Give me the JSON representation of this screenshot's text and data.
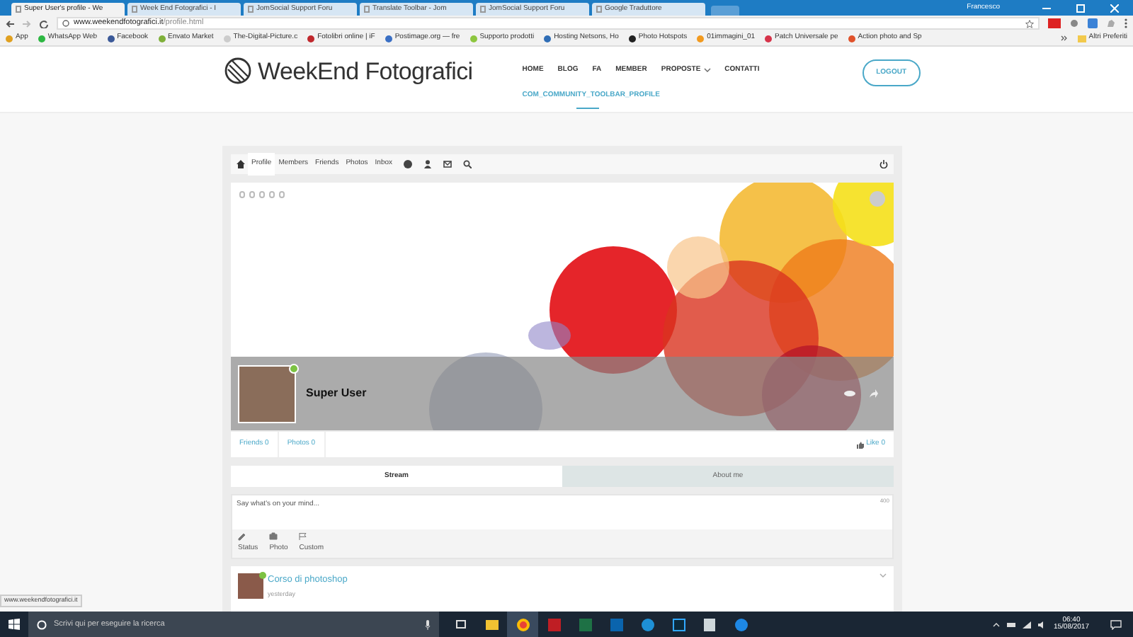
{
  "browser": {
    "tabs": [
      {
        "title": "Super User's profile - We",
        "selected": true
      },
      {
        "title": "Week End Fotografici - I",
        "selected": false
      },
      {
        "title": "JomSocial Support Foru",
        "selected": false
      },
      {
        "title": "Translate Toolbar - Jom",
        "selected": false
      },
      {
        "title": "JomSocial Support Foru",
        "selected": false
      },
      {
        "title": "Google Traduttore",
        "selected": false
      }
    ],
    "user": "Francesco",
    "url_host": "www.weekendfotografici.it",
    "url_path": "/profile.html",
    "bookmarks": [
      {
        "label": "App",
        "color": "#e0a020"
      },
      {
        "label": "WhatsApp Web",
        "color": "#2db742"
      },
      {
        "label": "Facebook",
        "color": "#3b5998"
      },
      {
        "label": "Envato Market",
        "color": "#7fb03a"
      },
      {
        "label": "The-Digital-Picture.c",
        "color": "#cccccc"
      },
      {
        "label": "Fotolibri online | iF",
        "color": "#c0282d"
      },
      {
        "label": "Postimage.org — fre",
        "color": "#3a6fc4"
      },
      {
        "label": "Supporto prodotti",
        "color": "#8dc63f"
      },
      {
        "label": "Hosting Netsons, Ho",
        "color": "#2f6db5"
      },
      {
        "label": "Photo Hotspots",
        "color": "#222222"
      },
      {
        "label": "01immagini_01",
        "color": "#f29a1f"
      },
      {
        "label": "Patch Universale pe",
        "color": "#d6334a"
      },
      {
        "label": "Action photo and Sp",
        "color": "#e0522b"
      }
    ],
    "other_bookmarks": "Altri Preferiti"
  },
  "site": {
    "logo": "WeekEnd Fotografici",
    "nav": [
      {
        "label": "HOME",
        "dropdown": false
      },
      {
        "label": "BLOG",
        "dropdown": false
      },
      {
        "label": "FA",
        "dropdown": false
      },
      {
        "label": "MEMBER",
        "dropdown": false
      },
      {
        "label": "PROPOSTE",
        "dropdown": true
      },
      {
        "label": "CONTATTI",
        "dropdown": false
      }
    ],
    "subnav": "COM_COMMUNITY_TOOLBAR_PROFILE",
    "logout": "LOGOUT"
  },
  "toolbar": [
    {
      "label": "Profile",
      "selected": true
    },
    {
      "label": "Members",
      "selected": false
    },
    {
      "label": "Friends",
      "selected": false
    },
    {
      "label": "Photos",
      "selected": false
    },
    {
      "label": "Inbox",
      "selected": false
    }
  ],
  "profile": {
    "name": "Super User",
    "online": true,
    "stats": [
      {
        "label": "Friends",
        "count": "0"
      },
      {
        "label": "Photos",
        "count": "0"
      }
    ],
    "like": "Like",
    "like_count": "0"
  },
  "stream_tabs": [
    {
      "label": "Stream",
      "selected": true
    },
    {
      "label": "About me",
      "selected": false
    }
  ],
  "composer": {
    "placeholder": "Say what's on your mind...",
    "counter": "400",
    "actions": [
      {
        "label": "Status"
      },
      {
        "label": "Photo"
      },
      {
        "label": "Custom"
      }
    ]
  },
  "post": {
    "title": "Corso di photoshop",
    "time": "yesterday",
    "online": true
  },
  "status_url": "www.weekendfotografici.it",
  "taskbar": {
    "search_placeholder": "Scrivi qui per eseguire la ricerca",
    "time": "06:40",
    "date": "15/08/2017"
  }
}
